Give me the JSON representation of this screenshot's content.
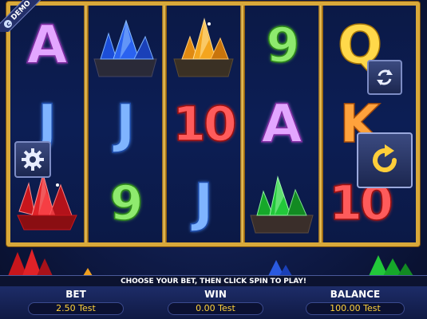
{
  "badge": {
    "label": "DEMO",
    "icon": "coin-icon"
  },
  "reels": [
    [
      "A",
      "J",
      "red-crystal"
    ],
    [
      "blue-crystal",
      "J",
      "9"
    ],
    [
      "orange-crystal",
      "10",
      "J"
    ],
    [
      "9",
      "A",
      "green-crystal"
    ],
    [
      "Q",
      "K",
      "10"
    ]
  ],
  "controls": {
    "autoplay_icon": "autoplay-icon",
    "settings_icon": "gear-icon",
    "spin_icon": "spin-icon"
  },
  "message": "CHOOSE YOUR BET, THEN CLICK SPIN TO PLAY!",
  "panel": {
    "bet_label": "BET",
    "bet_value": "2.50 Test",
    "win_label": "WIN",
    "win_value": "0.00 Test",
    "balance_label": "BALANCE",
    "balance_value": "100.00 Test"
  },
  "colors": {
    "frame": "#d9a93a",
    "value_text": "#ffd23a",
    "background": "#0e1a46"
  }
}
